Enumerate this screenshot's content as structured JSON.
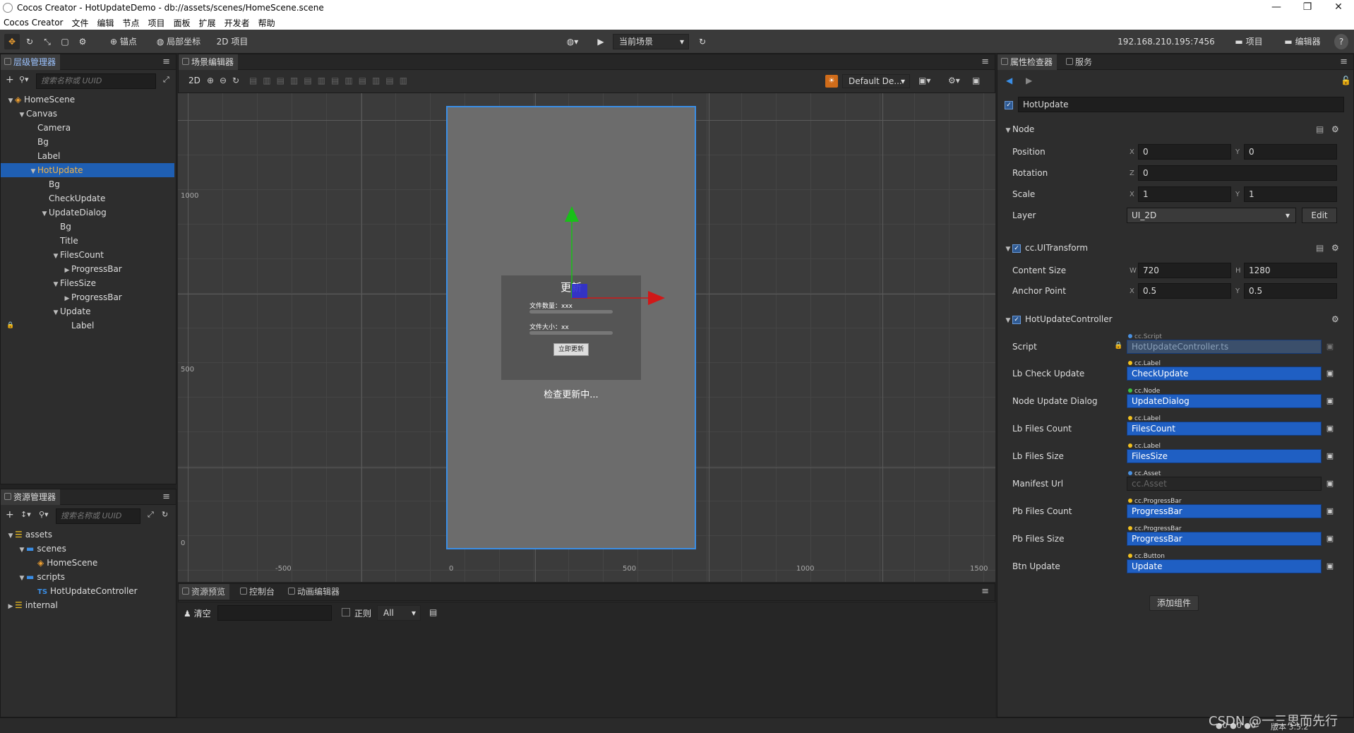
{
  "window": {
    "title": "Cocos Creator - HotUpdateDemo - db://assets/scenes/HomeScene.scene",
    "controls": [
      "—",
      "❐",
      "✕"
    ]
  },
  "menu": [
    "Cocos Creator",
    "文件",
    "编辑",
    "节点",
    "项目",
    "面板",
    "扩展",
    "开发者",
    "帮助"
  ],
  "toolbar": {
    "anchor_label": "锚点",
    "local_coord_label": "局部坐标",
    "project_type": "2D 项目",
    "current_scene": "当前场景",
    "ip": "192.168.210.195:7456",
    "project_btn": "项目",
    "editor_btn": "编辑器",
    "help": "?"
  },
  "hierarchy": {
    "tab": "层级管理器",
    "search_placeholder": "搜索名称或 UUID",
    "nodes": [
      {
        "label": "HomeScene",
        "indent": 0,
        "arrow": "▼",
        "icon": "scene-icon"
      },
      {
        "label": "Canvas",
        "indent": 1,
        "arrow": "▼"
      },
      {
        "label": "Camera",
        "indent": 2,
        "arrow": ""
      },
      {
        "label": "Bg",
        "indent": 2,
        "arrow": ""
      },
      {
        "label": "Label",
        "indent": 2,
        "arrow": ""
      },
      {
        "label": "HotUpdate",
        "indent": 2,
        "arrow": "▼",
        "selected": true
      },
      {
        "label": "Bg",
        "indent": 3,
        "arrow": ""
      },
      {
        "label": "CheckUpdate",
        "indent": 3,
        "arrow": ""
      },
      {
        "label": "UpdateDialog",
        "indent": 3,
        "arrow": "▼"
      },
      {
        "label": "Bg",
        "indent": 4,
        "arrow": ""
      },
      {
        "label": "Title",
        "indent": 4,
        "arrow": ""
      },
      {
        "label": "FilesCount",
        "indent": 4,
        "arrow": "▼"
      },
      {
        "label": "ProgressBar",
        "indent": 5,
        "arrow": "▶"
      },
      {
        "label": "FilesSize",
        "indent": 4,
        "arrow": "▼"
      },
      {
        "label": "ProgressBar",
        "indent": 5,
        "arrow": "▶"
      },
      {
        "label": "Update",
        "indent": 4,
        "arrow": "▼"
      },
      {
        "label": "Label",
        "indent": 5,
        "arrow": "",
        "locked": true
      }
    ]
  },
  "assets": {
    "tab": "资源管理器",
    "search_placeholder": "搜索名称或 UUID",
    "items": [
      {
        "label": "assets",
        "indent": 0,
        "arrow": "▼",
        "icon": "db-icon"
      },
      {
        "label": "scenes",
        "indent": 1,
        "arrow": "▼",
        "icon": "folder-icon"
      },
      {
        "label": "HomeScene",
        "indent": 2,
        "arrow": "",
        "icon": "scene-icon"
      },
      {
        "label": "scripts",
        "indent": 1,
        "arrow": "▼",
        "icon": "folder-icon"
      },
      {
        "label": "HotUpdateController",
        "indent": 2,
        "arrow": "",
        "icon": "ts-icon",
        "prefix": "TS"
      },
      {
        "label": "internal",
        "indent": 0,
        "arrow": "▶",
        "icon": "db-icon"
      }
    ]
  },
  "scene": {
    "tab": "场景编辑器",
    "mode_2d": "2D",
    "layout_select": "Default De...",
    "axis_y": [
      "1000",
      "500",
      "0"
    ],
    "axis_x": [
      "-500",
      "0",
      "500",
      "1000",
      "1500"
    ],
    "dialog_title": "更新",
    "files_count_label": "文件数量：xxx",
    "files_size_label": "文件大小：xx",
    "update_button": "立即更新",
    "checking_label": "检查更新中..."
  },
  "bottom": {
    "tabs": [
      "资源预览",
      "控制台",
      "动画编辑器"
    ],
    "clear": "清空",
    "regex": "正则",
    "level": "All"
  },
  "inspector": {
    "tabs": [
      "属性检查器",
      "服务"
    ],
    "node_name": "HotUpdate",
    "node_section": "Node",
    "position": {
      "label": "Position",
      "x": "0",
      "y": "0"
    },
    "rotation": {
      "label": "Rotation",
      "z": "0"
    },
    "scale": {
      "label": "Scale",
      "x": "1",
      "y": "1"
    },
    "layer": {
      "label": "Layer",
      "value": "UI_2D",
      "edit": "Edit"
    },
    "ui_transform": "cc.UITransform",
    "content_size": {
      "label": "Content Size",
      "w": "720",
      "h": "1280"
    },
    "anchor_point": {
      "label": "Anchor Point",
      "x": "0.5",
      "y": "0.5"
    },
    "controller": "HotUpdateController",
    "script": {
      "label": "Script",
      "type": "cc.Script",
      "value": "HotUpdateController.ts"
    },
    "props": [
      {
        "label": "Lb Check Update",
        "type": "cc.Label",
        "value": "CheckUpdate",
        "dot": "#f0c020"
      },
      {
        "label": "Node Update Dialog",
        "type": "cc.Node",
        "value": "UpdateDialog",
        "dot": "#40c040"
      },
      {
        "label": "Lb Files Count",
        "type": "cc.Label",
        "value": "FilesCount",
        "dot": "#f0c020"
      },
      {
        "label": "Lb Files Size",
        "type": "cc.Label",
        "value": "FilesSize",
        "dot": "#f0c020"
      },
      {
        "label": "Manifest Url",
        "type": "cc.Asset",
        "value": "cc.Asset",
        "dot": "#4a90e0",
        "empty": true
      },
      {
        "label": "Pb Files Count",
        "type": "cc.ProgressBar",
        "value": "ProgressBar",
        "dot": "#f0c020"
      },
      {
        "label": "Pb Files Size",
        "type": "cc.ProgressBar",
        "value": "ProgressBar",
        "dot": "#f0c020"
      },
      {
        "label": "Btn Update",
        "type": "cc.Button",
        "value": "Update",
        "dot": "#f0c020"
      }
    ],
    "add_component": "添加组件"
  },
  "status": {
    "errors": "0",
    "warnings": "0",
    "logs": "0",
    "version": "版本 3.5.2",
    "watermark": "CSDN @一三思而先行"
  },
  "colors": {
    "accent": "#1f5fb3",
    "selected_text": "#f0b44c",
    "gizmo_x": "#d01818",
    "gizmo_y": "#18c018",
    "canvas_border": "#3a8ee6"
  }
}
